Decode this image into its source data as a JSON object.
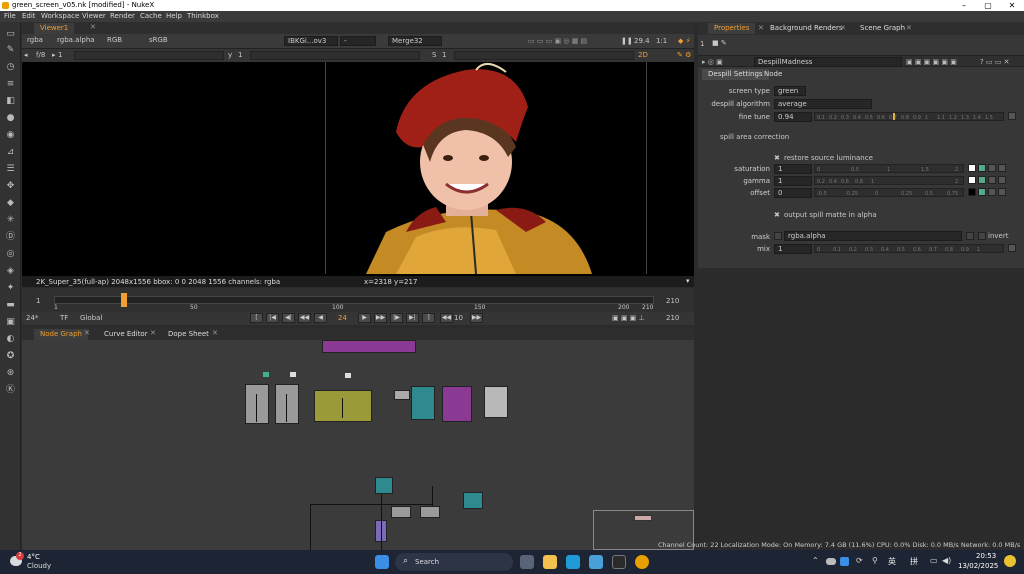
{
  "window": {
    "title": "green_screen_v05.nk [modified] - NukeX"
  },
  "menubar": [
    "File",
    "Edit",
    "Workspace",
    "Viewer",
    "Render",
    "Cache",
    "Help",
    "Thinkbox"
  ],
  "viewer": {
    "tab_label": "Viewer1",
    "channels": "rgba",
    "alpha_channel": "rgba.alpha",
    "display": "RGB",
    "colorspace": "sRGB",
    "input_a": "IBKGi...ov3",
    "input_a_op": "-",
    "input_b": "Merge32",
    "zoom_percent": "29.4",
    "zoom_ratio": "1:1",
    "fstop": "f/8",
    "frame_field": "1",
    "y_field": "1",
    "s_field": "1",
    "view_mode": "2D",
    "info_format": "2K_Super_35(full-ap) 2048x1556  bbox: 0 0 2048 1556 channels: rgba",
    "info_coords": "x=2318 y=217"
  },
  "timeline": {
    "start": "1",
    "end": "210",
    "current_frame": "24",
    "ticks": [
      "1",
      "50",
      "100",
      "150",
      "200",
      "210"
    ],
    "current_position": 0.11,
    "fps": "24*",
    "tf": "TF",
    "global": "Global",
    "increment": "10",
    "end_frame_field": "210"
  },
  "nodegraph_tabs": [
    "Node Graph",
    "Curve Editor",
    "Dope Sheet"
  ],
  "properties": {
    "tabs": [
      "Properties",
      "Background Renders",
      "Scene Graph"
    ],
    "count": "1",
    "node_name": "DespillMadness",
    "subtabs": [
      "Despill Settings",
      "Node"
    ],
    "screen_type_label": "screen type",
    "screen_type": "green",
    "despill_algorithm_label": "despill algorithm",
    "despill_algorithm": "average",
    "fine_tune_label": "fine tune",
    "fine_tune": "0.94",
    "fine_tune_ticks": [
      "0.1",
      "0.2",
      "0.3",
      "0.4",
      "0.5",
      "0.6",
      "0.7",
      "0.8",
      "0.9",
      "1",
      "1.1",
      "1.2",
      "1.3",
      "1.4",
      "1.5"
    ],
    "spill_section": "spill area correction",
    "restore_label": "restore source luminance",
    "saturation_label": "saturation",
    "saturation": "1",
    "sat_ticks": [
      "0",
      "0.5",
      "1",
      "1.5",
      "2"
    ],
    "gamma_label": "gamma",
    "gamma": "1",
    "gamma_ticks": [
      "0.2",
      "0.4",
      "0.6",
      "0.8",
      "1",
      "2"
    ],
    "offset_label": "offset",
    "offset": "0",
    "offset_ticks": [
      "-0.5",
      "-0.25",
      "0",
      "0.25",
      "0.5",
      "0.75"
    ],
    "output_spill_label": "output spill matte in alpha",
    "mask_label": "mask",
    "mask_value": "rgba.alpha",
    "invert_label": "invert",
    "mix_label": "mix",
    "mix": "1",
    "mix_ticks": [
      "0",
      "0.1",
      "0.2",
      "0.3",
      "0.4",
      "0.5",
      "0.6",
      "0.7",
      "0.8",
      "0.9",
      "1"
    ]
  },
  "statusbar": "Channel Count: 22  Localization Mode: On  Memory: 7.4 GB (11.6%)  CPU: 0.0%  Disk: 0.0 MB/s  Network: 0.0 MB/s",
  "taskbar": {
    "weather_temp": "4°C",
    "weather_desc": "Cloudy",
    "weather_badge": "2",
    "search": "Search",
    "ime_lang": "英",
    "ime_mode": "拼",
    "time": "20:53",
    "date": "13/02/2025"
  },
  "colors": {
    "accent": "#f0a030",
    "node_purple": "#8a3a92",
    "node_olive": "#9a9a38",
    "node_teal": "#2e8a8e"
  }
}
